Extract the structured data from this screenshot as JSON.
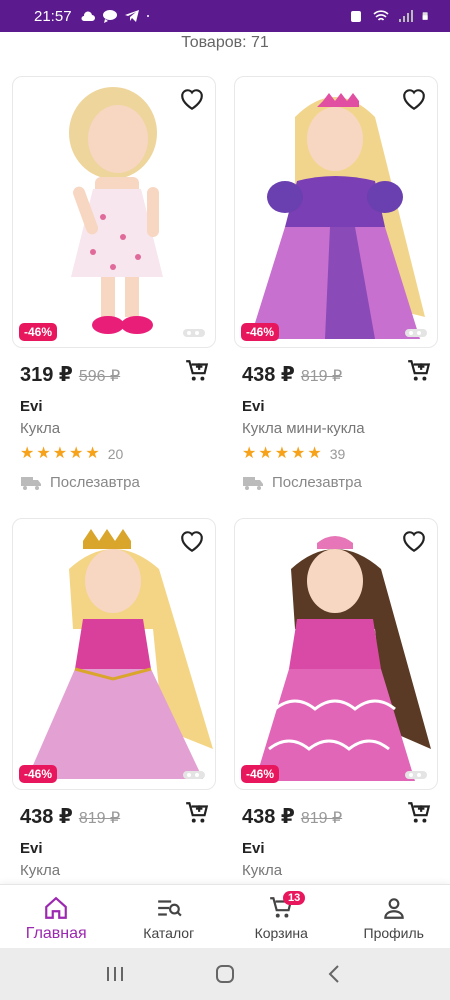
{
  "status": {
    "time": "21:57"
  },
  "header": {
    "count_text": "Товаров: 71"
  },
  "products": [
    {
      "price": "319 ₽",
      "old_price": "596 ₽",
      "discount": "-46%",
      "brand": "Evi",
      "type": "Кукла",
      "rating_count": "20",
      "delivery": "Послезавтра",
      "dress": "#f6dfe9",
      "hair": "#f0d49a"
    },
    {
      "price": "438 ₽",
      "old_price": "819 ₽",
      "discount": "-46%",
      "brand": "Evi",
      "type": "Кукла мини-кукла",
      "rating_count": "39",
      "delivery": "Послезавтра",
      "dress": "#b35ac8",
      "hair": "#f2d58d"
    },
    {
      "price": "438 ₽",
      "old_price": "819 ₽",
      "discount": "-46%",
      "brand": "Evi",
      "type": "Кукла",
      "dress": "#d98ac6",
      "hair": "#f3d585"
    },
    {
      "price": "438 ₽",
      "old_price": "819 ₽",
      "discount": "-46%",
      "brand": "Evi",
      "type": "Кукла",
      "dress": "#dd68b5",
      "hair": "#5a3a24"
    }
  ],
  "nav": {
    "home": "Главная",
    "catalog": "Каталог",
    "cart": "Корзина",
    "cart_badge": "13",
    "profile": "Профиль"
  },
  "colors": {
    "accent": "#9c27b0",
    "statusbar": "#5b1a8e",
    "discount": "#e8175d",
    "star": "#f6a21a"
  },
  "icons": [
    "heart-icon",
    "cart-add-icon",
    "truck-icon",
    "home-icon",
    "catalog-icon",
    "cart-icon",
    "profile-icon"
  ]
}
